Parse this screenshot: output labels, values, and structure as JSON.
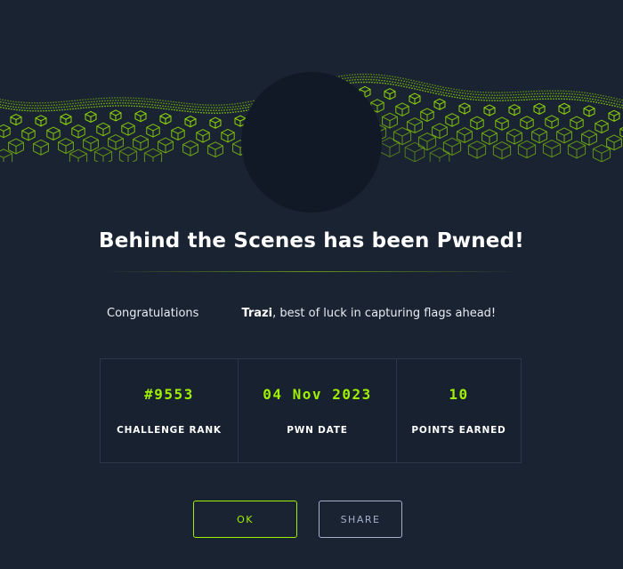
{
  "modal": {
    "title": "Behind the Scenes has been Pwned!",
    "congrats_prefix": "Congratulations",
    "username": "Trazi",
    "congrats_suffix": ", best of luck in capturing flags ahead!"
  },
  "stats": [
    {
      "value": "#9553",
      "label": "CHALLENGE RANK"
    },
    {
      "value": "04 Nov 2023",
      "label": "PWN DATE"
    },
    {
      "value": "10",
      "label": "POINTS EARNED"
    }
  ],
  "buttons": {
    "ok_label": "OK",
    "share_label": "SHARE"
  },
  "colors": {
    "accent": "#9fef00",
    "background": "#1a2332",
    "secondary": "#a4b1cd"
  },
  "icons": {
    "banner": "green-cube-wave-banner"
  }
}
